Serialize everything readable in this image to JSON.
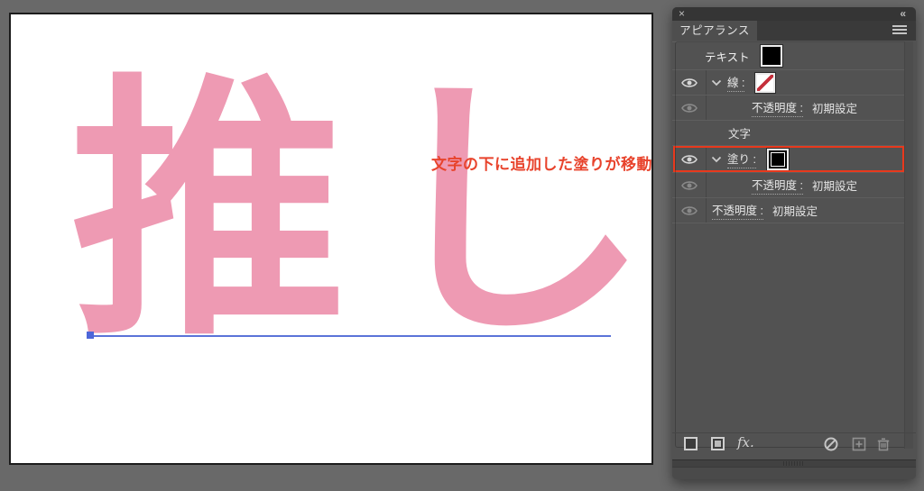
{
  "canvas": {
    "artwork_text": "推し",
    "artwork_color": "#ee9ab3",
    "annotation_text": "文字の下に追加した塗りが移動",
    "annotation_color": "#e8432c",
    "path_color": "#5b73d8"
  },
  "panel": {
    "header": {
      "close_glyph": "×",
      "collapse_glyph": "«",
      "tab_title": "アピアランス"
    },
    "rows": [
      {
        "id": "text-object",
        "label": "テキスト",
        "link": false,
        "eye": null,
        "chevron": false,
        "swatch": "black",
        "value": "",
        "nested": false,
        "highlight": false
      },
      {
        "id": "stroke",
        "label": "線 :",
        "link": true,
        "eye": "on",
        "chevron": true,
        "swatch": "none",
        "value": "",
        "nested": false,
        "highlight": false
      },
      {
        "id": "stroke-opacity",
        "label": "不透明度 :",
        "link": true,
        "eye": "dim",
        "chevron": false,
        "swatch": null,
        "value": "初期設定",
        "nested": true,
        "highlight": false
      },
      {
        "id": "characters",
        "label": "文字",
        "link": false,
        "eye": null,
        "chevron": false,
        "swatch": null,
        "value": "",
        "nested": false,
        "highlight": false
      },
      {
        "id": "fill",
        "label": "塗り :",
        "link": true,
        "eye": "on",
        "chevron": true,
        "swatch": "blacksel",
        "value": "",
        "nested": false,
        "highlight": true
      },
      {
        "id": "fill-opacity",
        "label": "不透明度 :",
        "link": true,
        "eye": "dim",
        "chevron": false,
        "swatch": null,
        "value": "初期設定",
        "nested": true,
        "highlight": false
      },
      {
        "id": "object-opacity",
        "label": "不透明度 :",
        "link": true,
        "eye": "dim",
        "chevron": false,
        "swatch": null,
        "value": "初期設定",
        "nested": false,
        "highlight": false
      }
    ],
    "footer": {
      "fx_label": "fx."
    },
    "highlight_color": "#e8391d"
  }
}
